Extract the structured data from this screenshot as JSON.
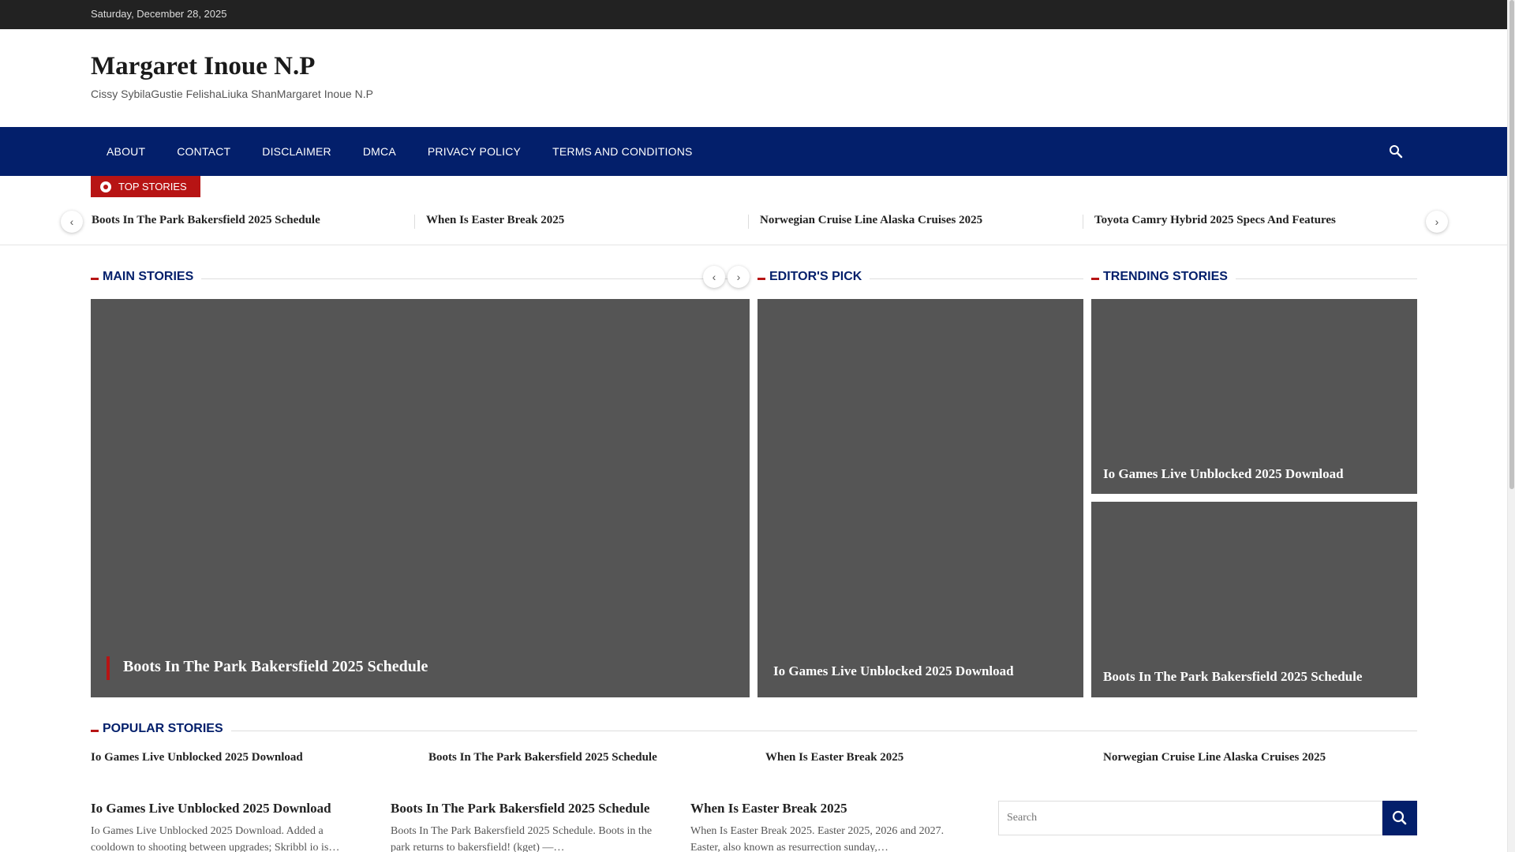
{
  "topbar": {
    "date": "Saturday, December 28, 2025"
  },
  "site": {
    "title": "Margaret Inoue N.P",
    "description": "Cissy SybilaGustie FelishaLiuka ShanMargaret Inoue N.P"
  },
  "nav": {
    "items": [
      "ABOUT",
      "CONTACT",
      "DISCLAIMER",
      "DMCA",
      "PRIVACY POLICY",
      "TERMS AND CONDITIONS"
    ],
    "search_icon": "search-icon"
  },
  "top_stories": {
    "label": "TOP STORIES",
    "items": [
      "Boots In The Park Bakersfield 2025 Schedule",
      "When Is Easter Break 2025",
      "Norwegian Cruise Line Alaska Cruises 2025",
      "Toyota Camry Hybrid 2025 Specs And Features"
    ]
  },
  "sections": {
    "main": "MAIN STORIES",
    "editors": "EDITOR'S PICK",
    "trending": "TRENDING STORIES",
    "popular": "POPULAR STORIES"
  },
  "main_story": {
    "title": "Boots In The Park Bakersfield 2025 Schedule"
  },
  "editors_pick": {
    "title": "Io Games Live Unblocked 2025 Download"
  },
  "trending": [
    {
      "title": "Io Games Live Unblocked 2025 Download"
    },
    {
      "title": "Boots In The Park Bakersfield 2025 Schedule"
    }
  ],
  "popular": [
    "Io Games Live Unblocked 2025 Download",
    "Boots In The Park Bakersfield 2025 Schedule",
    "When Is Easter Break 2025",
    "Norwegian Cruise Line Alaska Cruises 2025"
  ],
  "articles": [
    {
      "title": "Io Games Live Unblocked 2025 Download",
      "excerpt": "Io Games Live Unblocked 2025 Download. Added a cooldown to shooting between upgrades; Skribbl io is…"
    },
    {
      "title": "Boots In The Park Bakersfield 2025 Schedule",
      "excerpt": "Boots In The Park Bakersfield 2025 Schedule. Boots in the park returns to bakersfield! (kget) —…"
    },
    {
      "title": "When Is Easter Break 2025",
      "excerpt": "When Is Easter Break 2025. Easter 2025, 2026 and 2027. Easter, also known as resurrection sunday,…"
    }
  ],
  "search": {
    "placeholder": "Search"
  },
  "colors": {
    "nav": "#031f6b",
    "accent": "#b71414",
    "topbar": "#222222",
    "image_placeholder": "#555555"
  }
}
